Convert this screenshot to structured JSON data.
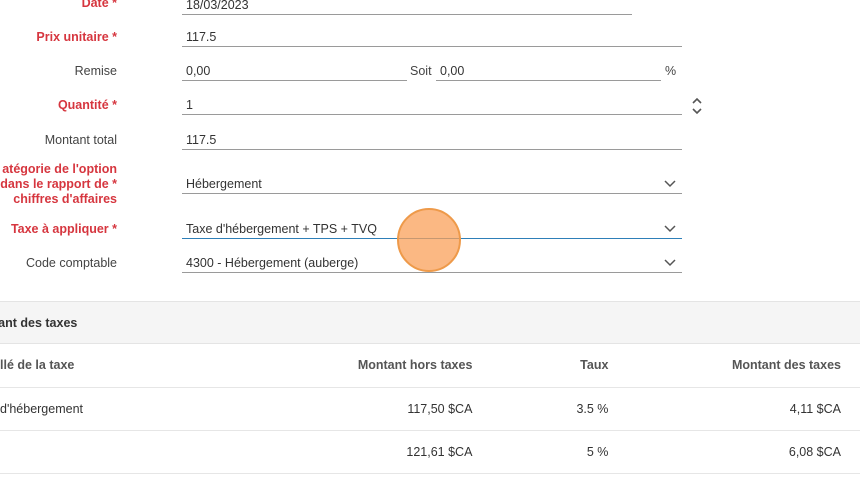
{
  "form": {
    "date": {
      "label": "Date *",
      "value": "18/03/2023"
    },
    "prix_unitaire": {
      "label": "Prix unitaire *",
      "value": "117.5"
    },
    "remise": {
      "label": "Remise",
      "value": "0,00",
      "soit_label": "Soit",
      "soit_value": "0,00",
      "percent": "%"
    },
    "quantite": {
      "label": "Quantité *",
      "value": "1"
    },
    "montant_total": {
      "label": "Montant total",
      "value": "117.5"
    },
    "categorie": {
      "label_line1": "atégorie de l'option",
      "label_line2": "dans le rapport de *",
      "label_line3": "chiffres d'affaires",
      "value": "Hébergement"
    },
    "taxe": {
      "label": "Taxe à appliquer *",
      "value": "Taxe d'hébergement + TPS + TVQ"
    },
    "code_comptable": {
      "label": "Code comptable",
      "value": "4300 - Hébergement (auberge)"
    }
  },
  "taxes_section": {
    "title": "tant des taxes",
    "columns": [
      "llé de la taxe",
      "Montant hors taxes",
      "Taux",
      "Montant des taxes"
    ],
    "rows": [
      {
        "name": "d'hébergement",
        "base": "117,50 $CA",
        "rate": "3.5 %",
        "amount": "4,11 $CA"
      },
      {
        "name": "",
        "base": "121,61 $CA",
        "rate": "5 %",
        "amount": "6,08 $CA"
      }
    ]
  },
  "colors": {
    "required": "#d6363f",
    "active_underline": "#2e7fb8",
    "highlight": "#f9a15a"
  },
  "icons": {
    "select": "chevron-down-icon",
    "stepper": "stepper-icon"
  }
}
